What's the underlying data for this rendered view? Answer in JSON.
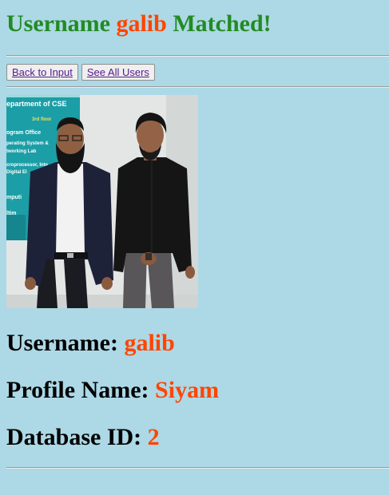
{
  "header": {
    "prefix": "Username ",
    "username": "galib",
    "suffix": " Matched!"
  },
  "buttons": {
    "back": "Back to Input",
    "all_users": "See All Users"
  },
  "photo": {
    "sign_lines": [
      "epartment of CSE",
      "3rd floor",
      "ogram Office",
      "perating System &",
      "tworking Lab",
      "croprocessor, Inte",
      "Digital El",
      "mputi",
      "ltim"
    ]
  },
  "details": {
    "username_label": "Username: ",
    "username_value": "galib",
    "profile_label": "Profile Name: ",
    "profile_value": "Siyam",
    "dbid_label": "Database ID: ",
    "dbid_value": "2"
  },
  "colors": {
    "background": "#add8e6",
    "title_green": "#228b22",
    "accent_orange": "#ff4500"
  }
}
